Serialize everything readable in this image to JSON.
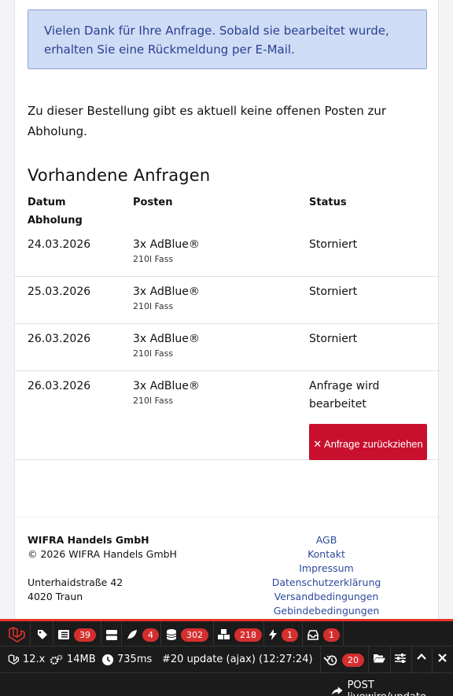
{
  "alert": {
    "text": "Vielen Dank für Ihre Anfrage. Sobald sie bearbeitet wurde, erhalten Sie eine Rückmeldung per E-Mail."
  },
  "note": "Zu dieser Bestellung gibt es aktuell keine offenen Posten zur Abholung.",
  "requests": {
    "title": "Vorhandene Anfragen",
    "headers": {
      "date": "Datum Abholung",
      "items": "Posten",
      "status": "Status"
    },
    "rows": [
      {
        "date": "24.03.2026",
        "item": "3x AdBlue®",
        "detail": "210l Fass",
        "status": "Storniert"
      },
      {
        "date": "25.03.2026",
        "item": "3x AdBlue®",
        "detail": "210l Fass",
        "status": "Storniert"
      },
      {
        "date": "26.03.2026",
        "item": "3x AdBlue®",
        "detail": "210l Fass",
        "status": "Storniert"
      },
      {
        "date": "26.03.2026",
        "item": "3x AdBlue®",
        "detail": "210l Fass",
        "status": "Anfrage wird bearbeitet",
        "action": "✕ Anfrage zurückziehen"
      }
    ]
  },
  "footer": {
    "company": "WIFRA Handels GmbH",
    "copyright": "© 2026 WIFRA Handels GmbH",
    "street": "Unterhaidstraße 42",
    "city": "4020 Traun",
    "links": [
      "AGB",
      "Kontakt",
      "Impressum",
      "Datenschutzerklärung",
      "Versandbedingungen",
      "Gebindebedingungen"
    ]
  },
  "debugbar": {
    "badges": {
      "messages": "39",
      "views": "4",
      "queries": "302",
      "models": "218",
      "events": "1",
      "mails": "1",
      "history": "20"
    },
    "version": "12.x",
    "memory": "14MB",
    "time": "735ms",
    "request": "#20 update (ajax) (12:27:24)",
    "route": "POST livewire/update"
  },
  "colors": {
    "accent": "#c8102e",
    "alert_bg": "#cfdcf6",
    "debug_bg": "#1b1b1b",
    "debug_badge": "#d42f2f"
  }
}
